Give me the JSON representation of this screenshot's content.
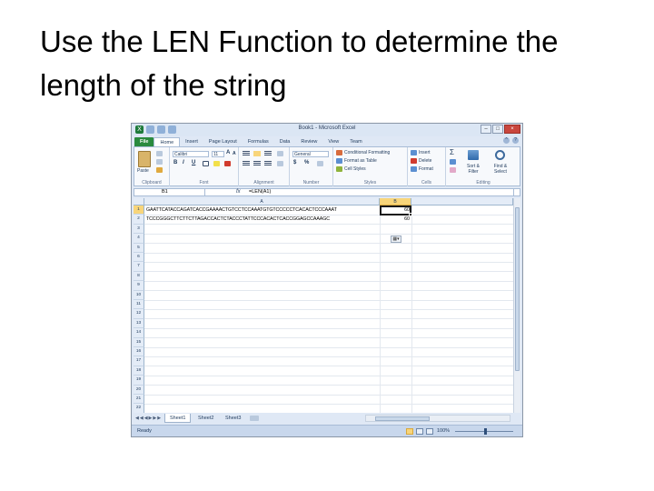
{
  "slide": {
    "title": "Use the LEN Function to determine the length of the string"
  },
  "window": {
    "title": "Book1 - Microsoft Excel",
    "app_icon": "excel-icon",
    "controls": [
      "–",
      "□",
      "×"
    ]
  },
  "ribbon": {
    "tabs": [
      "File",
      "Home",
      "Insert",
      "Page Layout",
      "Formulas",
      "Data",
      "Review",
      "View",
      "Team"
    ],
    "active_tab": "Home",
    "groups": {
      "clipboard": "Clipboard",
      "font": "Font",
      "alignment": "Alignment",
      "number": "Number",
      "styles": "Styles",
      "cells": "Cells",
      "editing": "Editing"
    },
    "paste_label": "Paste",
    "font_name": "Calibri",
    "font_size": "11",
    "bold": "B",
    "italic": "I",
    "underline": "U",
    "number_format": "General",
    "currency": "$",
    "percent": "%",
    "conditional_formatting": "Conditional Formatting",
    "format_as_table": "Format as Table",
    "cell_styles": "Cell Styles",
    "insert": "Insert",
    "delete": "Delete",
    "format": "Format",
    "sum": "Σ",
    "sort_filter": "Sort & Filter",
    "find_select": "Find & Select"
  },
  "formula_bar": {
    "name_box": "B1",
    "fx": "fx",
    "formula": "=LEN(A1)"
  },
  "grid": {
    "columns": [
      "A",
      "B"
    ],
    "selected_column": "B",
    "rows": [
      "1",
      "2",
      "3",
      "4",
      "5",
      "6",
      "7",
      "8",
      "9",
      "10",
      "11",
      "12",
      "13",
      "14",
      "15",
      "16",
      "17",
      "18",
      "19",
      "20",
      "21",
      "22"
    ],
    "cells": {
      "A1": "GAATTCATACCAGATCACCGAAAACTGTCCTCCAAATGTGTCCCCCTCACACTCCCAAAT",
      "A2": "TCCCGGGCTTCTTCTTAGACCACTCTACCCTATTCCCACACTCACCGGAGCCAAAGC",
      "B1": "60",
      "B2": "60"
    },
    "autofill_icon": "autofill-options-icon"
  },
  "sheet_tabs": {
    "tabs": [
      "Sheet1",
      "Sheet2",
      "Sheet3"
    ],
    "active": "Sheet1",
    "nav": "◀◀◀▶▶▶"
  },
  "status_bar": {
    "status": "Ready",
    "zoom": "100%"
  },
  "colors": {
    "file_tab": "#2a8a3e",
    "selection_header": "#f8d57a",
    "ribbon_bg": "#dfe8f5"
  }
}
